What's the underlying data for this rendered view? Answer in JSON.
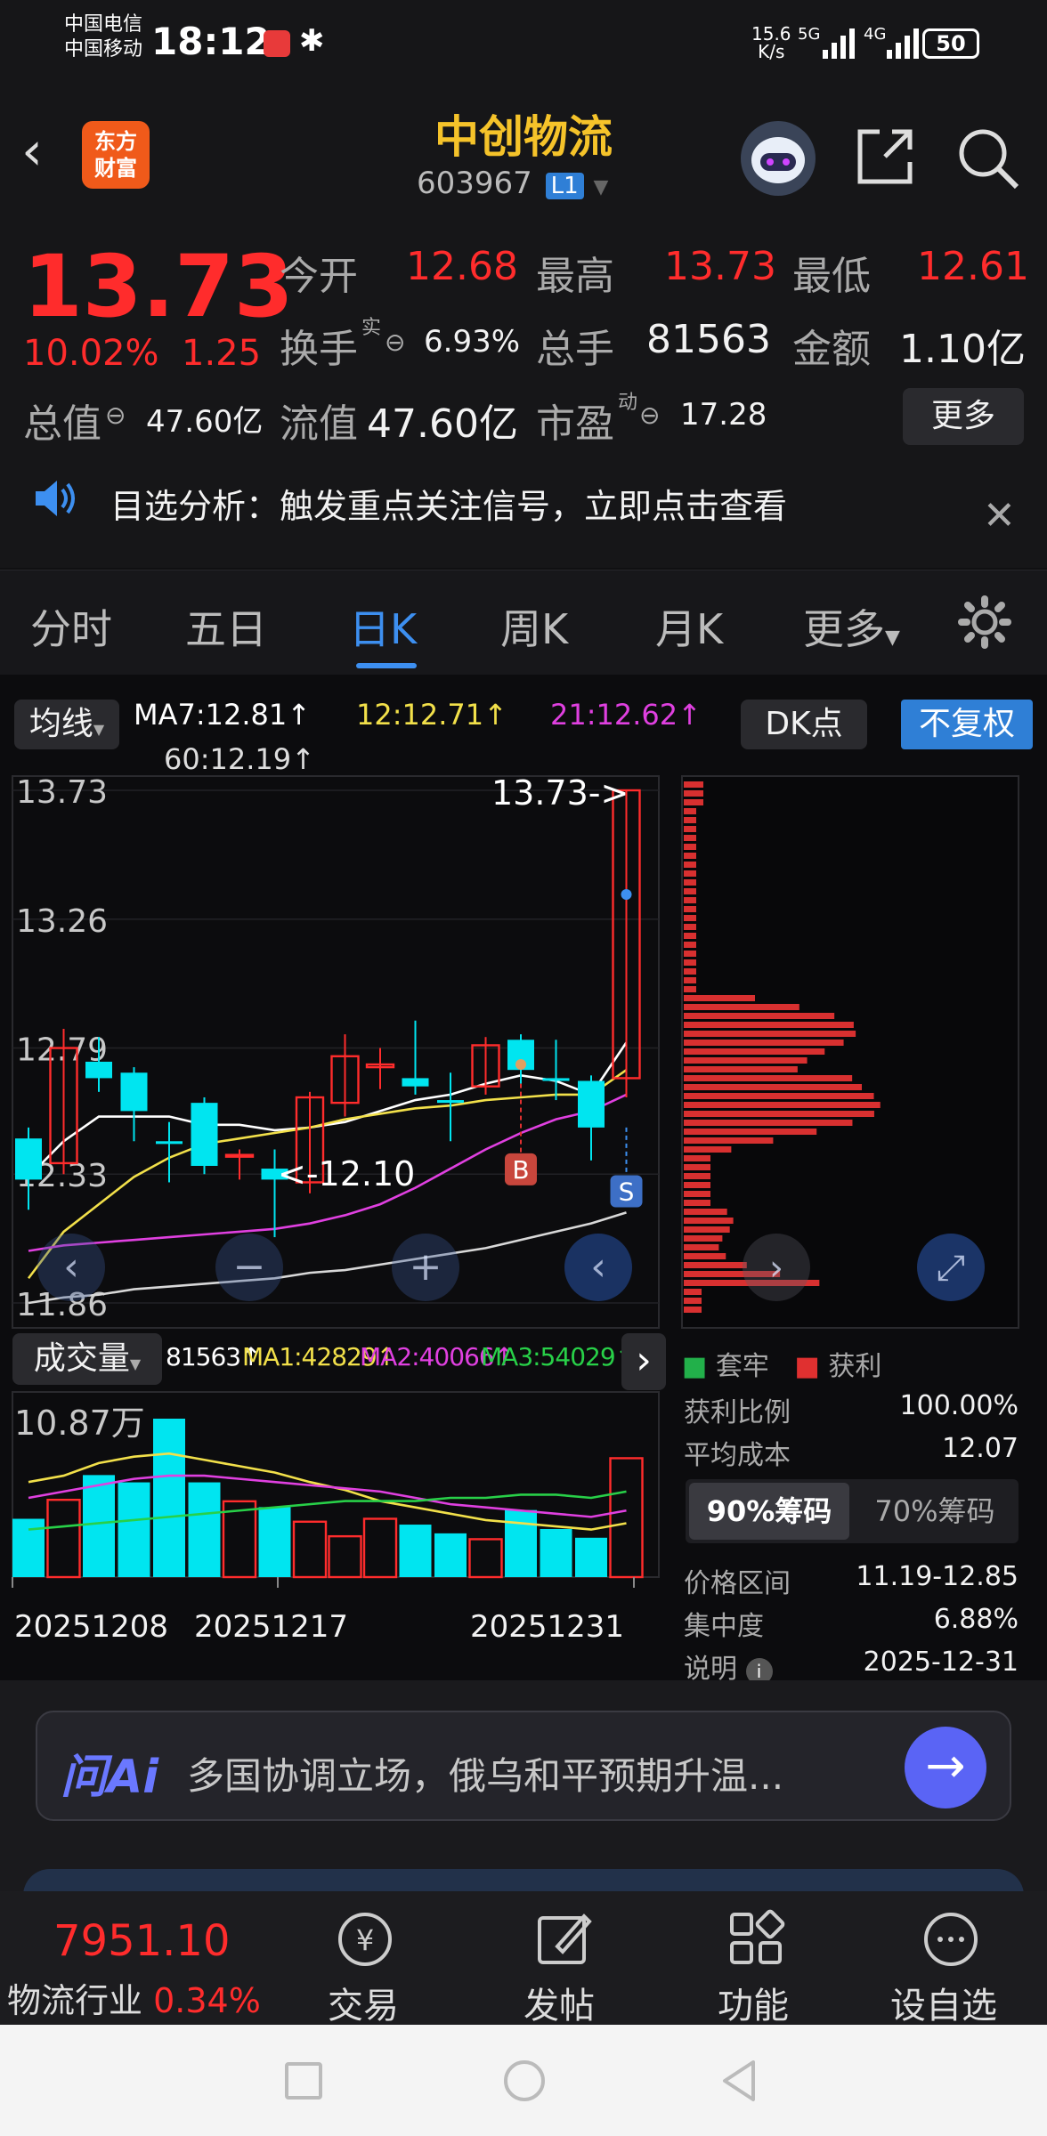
{
  "status": {
    "carrier1": "中国电信",
    "carrier2": "中国移动",
    "time": "18:12",
    "net_speed_top": "15.6",
    "net_speed_bottom": "K/s",
    "net1": "5G",
    "net2": "4G",
    "battery": "50"
  },
  "nav": {
    "logo_line1": "东方",
    "logo_line2": "财富",
    "stock_name": "中创物流",
    "stock_code": "603967",
    "level": "L1"
  },
  "quote": {
    "price": "13.73",
    "change_pct": "10.02%",
    "change": "1.25",
    "open_label": "今开",
    "open": "12.68",
    "high_label": "最高",
    "high": "13.73",
    "low_label": "最低",
    "low": "12.61",
    "turnover_label": "换手",
    "turnover_sup": "实",
    "turnover": "6.93%",
    "volume_label": "总手",
    "volume": "81563",
    "amount_label": "金额",
    "amount": "1.10亿",
    "mktcap_label": "总值",
    "mktcap": "47.60亿",
    "float_label": "流值",
    "float_cap": "47.60亿",
    "pe_label": "市盈",
    "pe_sup": "动",
    "pe": "17.28",
    "more": "更多"
  },
  "notice": {
    "text": "目选分析：触发重点关注信号，立即点击查看"
  },
  "tabs": [
    "分时",
    "五日",
    "日K",
    "周K",
    "月K",
    "更多"
  ],
  "active_tab": 2,
  "ma": {
    "selector": "均线",
    "ma7": "MA7:12.81↑",
    "ma12": "12:12.71↑",
    "ma21": "21:12.62↑",
    "ma60": "60:12.19↑",
    "dk": "DK点",
    "fq": "不复权"
  },
  "chart_data": {
    "type": "candlestick",
    "yticks": [
      "13.73",
      "13.26",
      "12.79",
      "12.33",
      "11.86"
    ],
    "ylim": [
      11.86,
      13.73
    ],
    "annotations": {
      "high": "13.73->",
      "low": "<-12.10",
      "buy": "B",
      "sell": "S"
    },
    "candles": [
      {
        "o": 12.46,
        "c": 12.31,
        "h": 12.5,
        "l": 12.2
      },
      {
        "o": 12.37,
        "c": 12.79,
        "h": 12.86,
        "l": 12.33
      },
      {
        "o": 12.74,
        "c": 12.68,
        "h": 12.83,
        "l": 12.63
      },
      {
        "o": 12.7,
        "c": 12.56,
        "h": 12.72,
        "l": 12.45
      },
      {
        "o": 12.45,
        "c": 12.44,
        "h": 12.52,
        "l": 12.3
      },
      {
        "o": 12.59,
        "c": 12.36,
        "h": 12.61,
        "l": 12.33
      },
      {
        "o": 12.4,
        "c": 12.4,
        "h": 12.42,
        "l": 12.31
      },
      {
        "o": 12.35,
        "c": 12.31,
        "h": 12.42,
        "l": 12.1
      },
      {
        "o": 12.3,
        "c": 12.61,
        "h": 12.63,
        "l": 12.26
      },
      {
        "o": 12.59,
        "c": 12.76,
        "h": 12.84,
        "l": 12.54
      },
      {
        "o": 12.72,
        "c": 12.73,
        "h": 12.79,
        "l": 12.64
      },
      {
        "o": 12.68,
        "c": 12.65,
        "h": 12.89,
        "l": 12.62
      },
      {
        "o": 12.6,
        "c": 12.59,
        "h": 12.7,
        "l": 12.45
      },
      {
        "o": 12.65,
        "c": 12.8,
        "h": 12.83,
        "l": 12.62
      },
      {
        "o": 12.82,
        "c": 12.71,
        "h": 12.84,
        "l": 12.66
      },
      {
        "o": 12.68,
        "c": 12.67,
        "h": 12.82,
        "l": 12.6
      },
      {
        "o": 12.67,
        "c": 12.5,
        "h": 12.69,
        "l": 12.38
      },
      {
        "o": 12.68,
        "c": 13.73,
        "h": 13.73,
        "l": 12.61
      }
    ],
    "ma_lines": [
      {
        "name": "MA7",
        "color": "#ffffff",
        "values": [
          12.32,
          12.45,
          12.54,
          12.54,
          12.54,
          12.51,
          12.51,
          12.49,
          12.5,
          12.52,
          12.56,
          12.6,
          12.62,
          12.66,
          12.69,
          12.67,
          12.62,
          12.81
        ]
      },
      {
        "name": "MA12",
        "color": "#f2e04a",
        "values": [
          11.95,
          12.12,
          12.22,
          12.32,
          12.39,
          12.44,
          12.46,
          12.48,
          12.5,
          12.53,
          12.55,
          12.57,
          12.58,
          12.6,
          12.61,
          12.62,
          12.62,
          12.71
        ]
      },
      {
        "name": "MA21",
        "color": "#e040e0",
        "values": [
          12.05,
          12.07,
          12.08,
          12.09,
          12.1,
          12.11,
          12.12,
          12.13,
          12.15,
          12.18,
          12.22,
          12.28,
          12.35,
          12.42,
          12.48,
          12.53,
          12.56,
          12.62
        ]
      },
      {
        "name": "MA60",
        "color": "#d8d8d8",
        "values": [
          11.86,
          11.88,
          11.89,
          11.91,
          11.92,
          11.93,
          11.94,
          11.95,
          11.97,
          11.98,
          12.0,
          12.02,
          12.04,
          12.06,
          12.09,
          12.12,
          12.15,
          12.19
        ]
      }
    ],
    "volume": {
      "label": "成交量",
      "max_label": "10.87万",
      "vol": "81563↑",
      "ma1": "MA1:42829↑",
      "ma2": "MA2:40066↑",
      "ma3": "MA3:54029↑",
      "max": 108700,
      "values": [
        40000,
        53000,
        70000,
        65000,
        108700,
        65000,
        52000,
        48000,
        38000,
        28000,
        40000,
        36000,
        30000,
        26000,
        46000,
        33000,
        27000,
        81563
      ]
    },
    "dates": [
      "20251208",
      "20251217",
      "20251231"
    ]
  },
  "chips": {
    "legend_trapped": "套牢",
    "legend_profit": "获利",
    "profit_ratio_label": "获利比例",
    "profit_ratio": "100.00%",
    "avg_cost_label": "平均成本",
    "avg_cost": "12.07",
    "tab90": "90%筹码",
    "tab70": "70%筹码",
    "range_label": "价格区间",
    "range": "11.19-12.85",
    "conc_label": "集中度",
    "conc": "6.88%",
    "note_label": "说明",
    "note": "2025-12-31"
  },
  "ai": {
    "logo": "问Ai",
    "text": "多国协调立场，俄乌和平预期升温..."
  },
  "bottom": {
    "index_value": "7951.10",
    "index_name": "物流行业",
    "index_pct": "0.34%",
    "trade": "交易",
    "post": "发帖",
    "func": "功能",
    "watch": "设自选"
  },
  "colors": {
    "up": "#ff2c2c",
    "down": "#00e5f0",
    "accent": "#f5a623",
    "tab_active": "#3d8ff0"
  }
}
